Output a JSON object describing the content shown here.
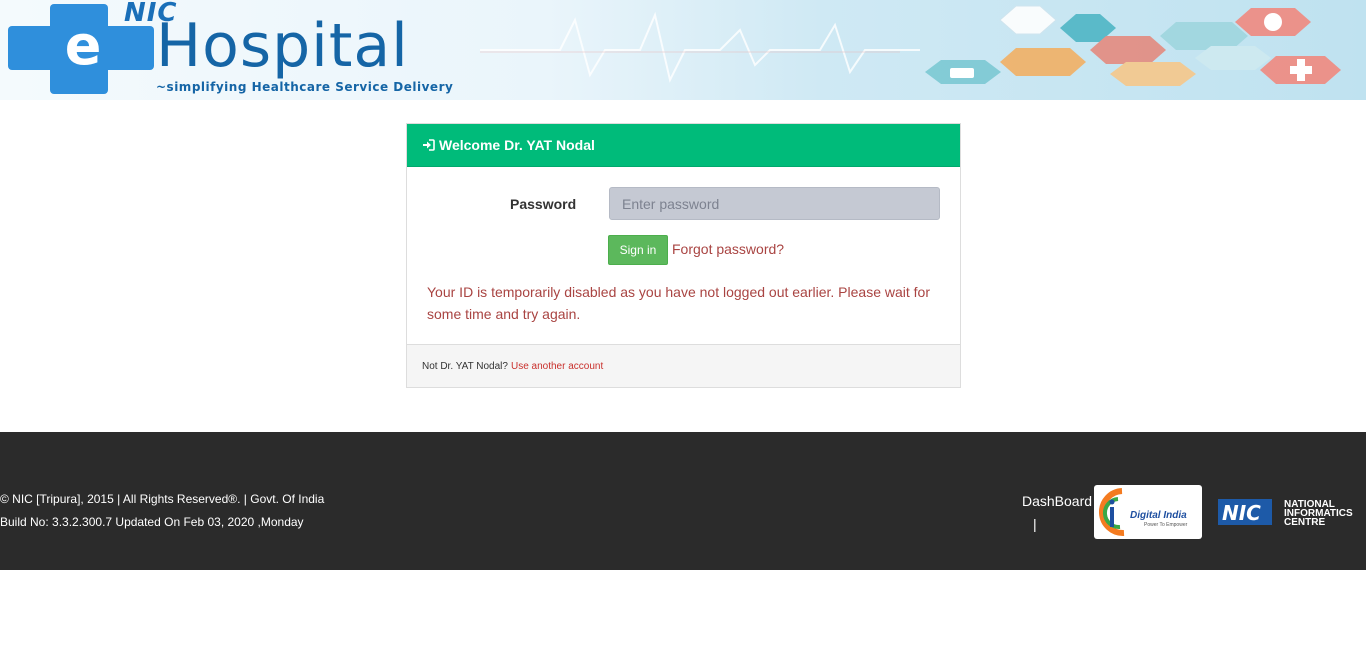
{
  "header": {
    "logo_nic": "NIC",
    "logo_e": "e",
    "logo_hospital": "Hospital",
    "logo_tagline": "~simplifying Healthcare Service Delivery"
  },
  "panel": {
    "heading_icon": "sign-in-icon",
    "heading": "Welcome Dr. YAT Nodal",
    "password_label": "Password",
    "password_value": "",
    "password_placeholder": "Enter password",
    "signin_label": "Sign in",
    "forgot_label": "Forgot password?",
    "error_message": "Your ID is temporarily disabled as you have not logged out earlier. Please wait for some time and try again.",
    "footer_text": "Not Dr. YAT Nodal?",
    "footer_link": "Use another account"
  },
  "footer": {
    "copyright": "© NIC [Tripura], 2015 | All Rights Reserved®. | Govt. Of India",
    "build": "Build No: 3.3.2.300.7 Updated On Feb 03, 2020 ,Monday",
    "dashboard_link": "DashBoard",
    "separator": "|",
    "digital_india_title": "Digital India",
    "digital_india_sub": "Power To Empower",
    "nic_logo_text": "NIC",
    "nic_name_line1": "NATIONAL",
    "nic_name_line2": "INFORMATICS",
    "nic_name_line3": "CENTRE"
  },
  "colors": {
    "header_green": "#00bb7a",
    "signin_green": "#5cb85c",
    "error_red": "#a94442",
    "footer_bg": "#2b2b2b"
  }
}
